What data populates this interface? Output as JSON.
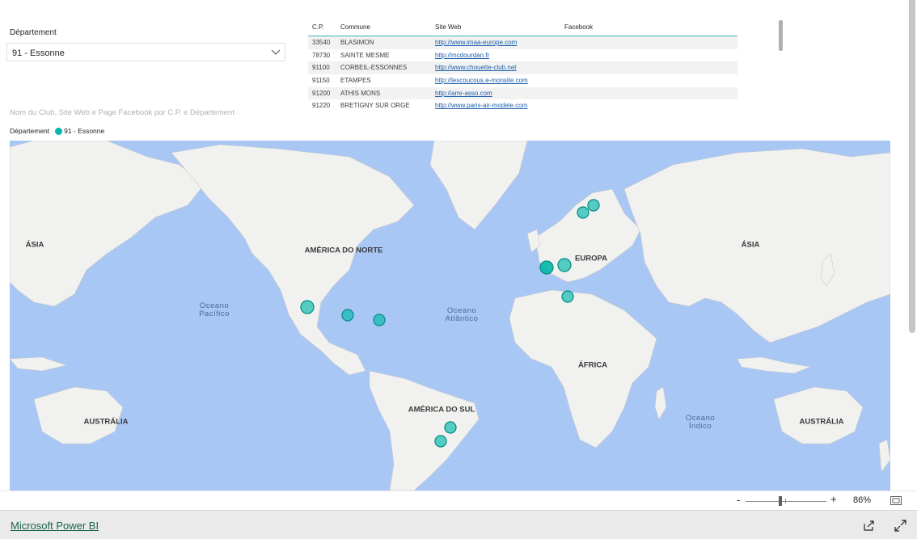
{
  "slicer": {
    "title": "Département",
    "selected": "91 - Essonne"
  },
  "table": {
    "headers": [
      "C.P.",
      "Commune",
      "Site Web",
      "Facebook"
    ],
    "rows": [
      {
        "cp": "33540",
        "commune": "BLASIMON",
        "site": "http://www.imaa-europe.com",
        "facebook": ""
      },
      {
        "cp": "78730",
        "commune": "SAINTE MESME",
        "site": "http://mcdourdan.fr",
        "facebook": ""
      },
      {
        "cp": "91100",
        "commune": "CORBEIL-ESSONNES",
        "site": "http://www.chouette-club.net",
        "facebook": ""
      },
      {
        "cp": "91150",
        "commune": "ETAMPES",
        "site": "http://lescoucous.e-monsite.com",
        "facebook": ""
      },
      {
        "cp": "91200",
        "commune": "ATHIS MONS",
        "site": "http://amr-asso.com",
        "facebook": ""
      },
      {
        "cp": "91220",
        "commune": "BRETIGNY SUR ORGE",
        "site": "http://www.paris-air-modele.com",
        "facebook": ""
      }
    ]
  },
  "map": {
    "subtitle": "Nom du Club, Site Web e Page Facebook por C.P. e Département",
    "legend_title": "Département",
    "legend_item": "91 - Essonne",
    "legend_color": "#01b8aa",
    "water_color": "#a8c7f5",
    "land_color": "#f1f1ef",
    "continent_labels": [
      "ÁSIA",
      "AMÉRICA DO NORTE",
      "EUROPA",
      "ÁFRICA",
      "ÁSIA",
      "AUSTRÁLIA",
      "AMÉRICA DO SUL",
      "AUSTRÁLIA"
    ],
    "ocean_labels": [
      "Oceano Pacífico",
      "Oceano Atlântico",
      "Oceano Índico"
    ]
  },
  "zoom": {
    "minus": "-",
    "plus": "+",
    "percent": "86%"
  },
  "footer": {
    "brand_link": "Microsoft Power BI"
  }
}
